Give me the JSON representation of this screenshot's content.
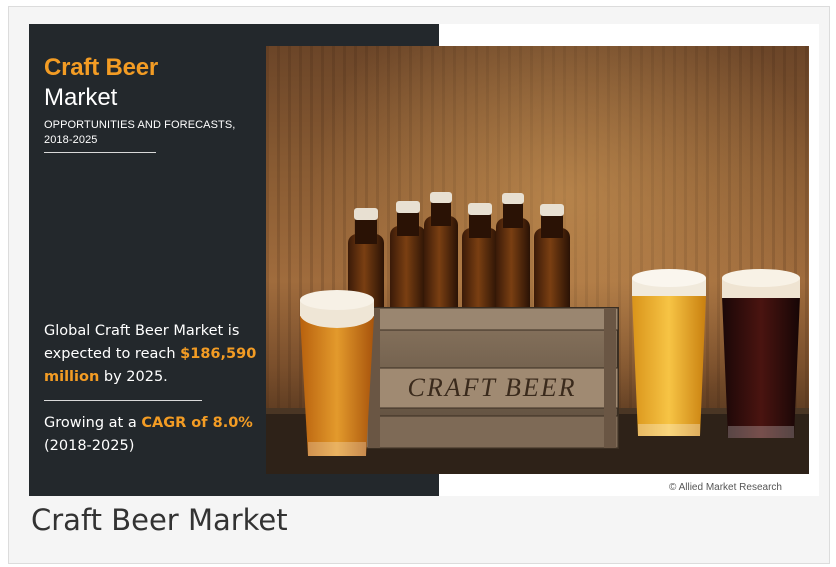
{
  "infographic": {
    "title_line1": "Craft Beer",
    "title_line2": "Market",
    "subtitle_line1": "OPPORTUNITIES AND FORECASTS,",
    "subtitle_line2": "2018-2025",
    "stat1_prefix": "Global Craft Beer Market is expected to reach ",
    "stat1_highlight": "$186,590 million",
    "stat1_suffix": " by 2025.",
    "stat2_prefix": "Growing at a ",
    "stat2_highlight": "CAGR of 8.0%",
    "stat2_suffix": " (2018-2025)",
    "crate_label": "CRAFT BEER",
    "copyright": "© Allied Market Research"
  },
  "caption": "Craft Beer Market",
  "colors": {
    "panel": "#23282c",
    "accent": "#f39c24"
  }
}
